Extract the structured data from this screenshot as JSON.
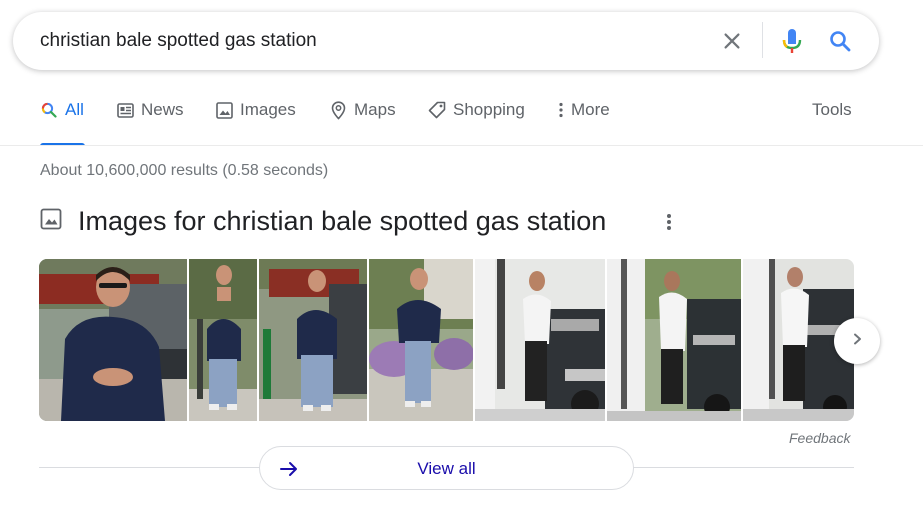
{
  "search": {
    "query": "christian bale spotted gas station",
    "icons": {
      "clear": "close-icon",
      "mic": "microphone-icon",
      "search": "search-icon"
    }
  },
  "tabs": [
    {
      "label": "All",
      "icon": "search-icon",
      "active": true
    },
    {
      "label": "News",
      "icon": "news-icon"
    },
    {
      "label": "Images",
      "icon": "image-icon"
    },
    {
      "label": "Maps",
      "icon": "map-pin-icon"
    },
    {
      "label": "Shopping",
      "icon": "tag-icon"
    },
    {
      "label": "More",
      "icon": "more-vert-icon"
    }
  ],
  "tools_label": "Tools",
  "result_stats": "About 10,600,000 results (0.58 seconds)",
  "images_block": {
    "title": "Images for christian bale spotted gas station",
    "feedback": "Feedback",
    "view_all": "View all"
  },
  "colors": {
    "accent": "#1a73e8",
    "link": "#1a0dab",
    "muted": "#70757a"
  }
}
